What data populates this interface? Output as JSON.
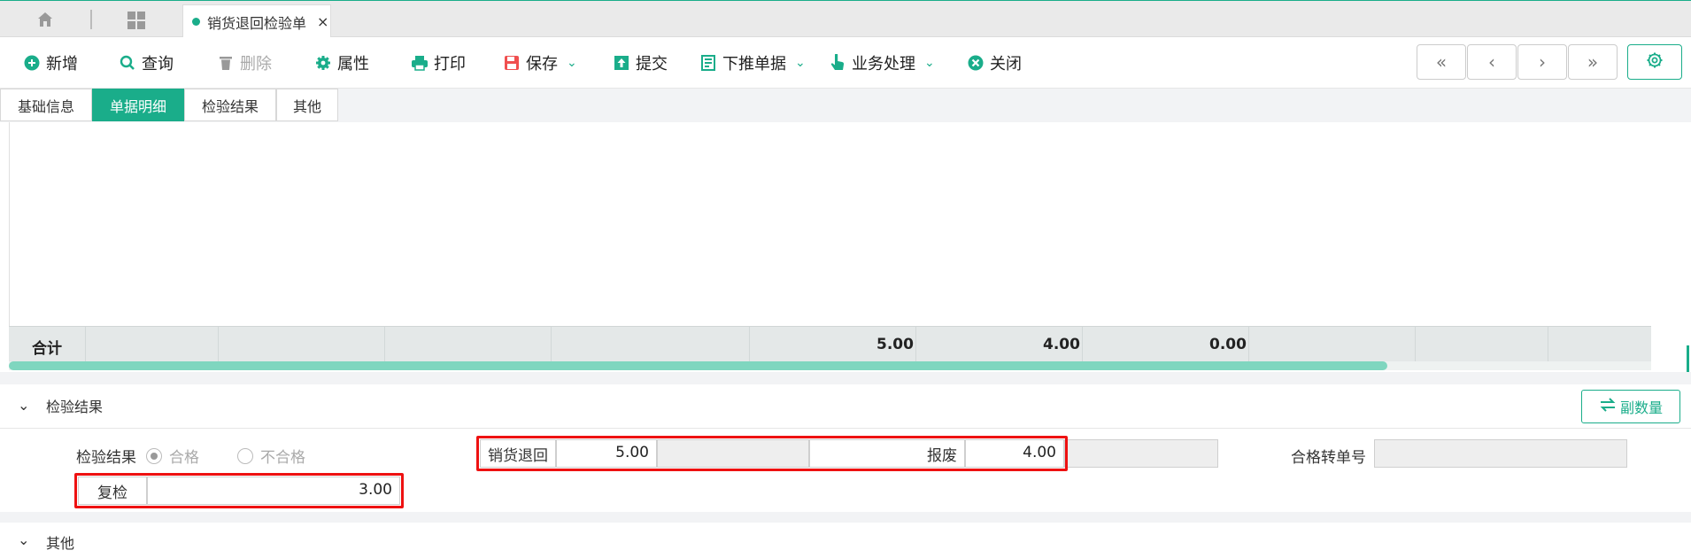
{
  "window_tabs": {
    "doc_tab_title": "销货退回检验单",
    "close_glyph": "×"
  },
  "toolbar": {
    "new_label": "新增",
    "query_label": "查询",
    "delete_label": "删除",
    "properties_label": "属性",
    "print_label": "打印",
    "save_label": "保存",
    "submit_label": "提交",
    "push_label": "下推单据",
    "business_label": "业务处理",
    "close_label": "关闭",
    "nav": [
      "«",
      "‹",
      "›",
      "»"
    ]
  },
  "sub_tabs": [
    {
      "label": "基础信息",
      "active": false
    },
    {
      "label": "单据明细",
      "active": true
    },
    {
      "label": "检验结果",
      "active": false
    },
    {
      "label": "其他",
      "active": false
    }
  ],
  "grid": {
    "total_label": "合计",
    "totals": [
      "5.00",
      "4.00",
      "0.00"
    ]
  },
  "inspection_section": {
    "title": "检验结果",
    "secondary_qty_button": "副数量",
    "result_label": "检验结果",
    "option_pass": "合格",
    "option_fail": "不合格",
    "return_label": "销货退回",
    "return_value": "5.00",
    "scrap_label": "报废",
    "scrap_value": "4.00",
    "pass_transfer_label": "合格转单号",
    "pass_transfer_value": "",
    "recheck_label": "复检",
    "recheck_value": "3.00"
  },
  "other_section": {
    "title": "其他"
  },
  "colors": {
    "accent": "#1aad8a",
    "highlight": "#ee1111"
  }
}
